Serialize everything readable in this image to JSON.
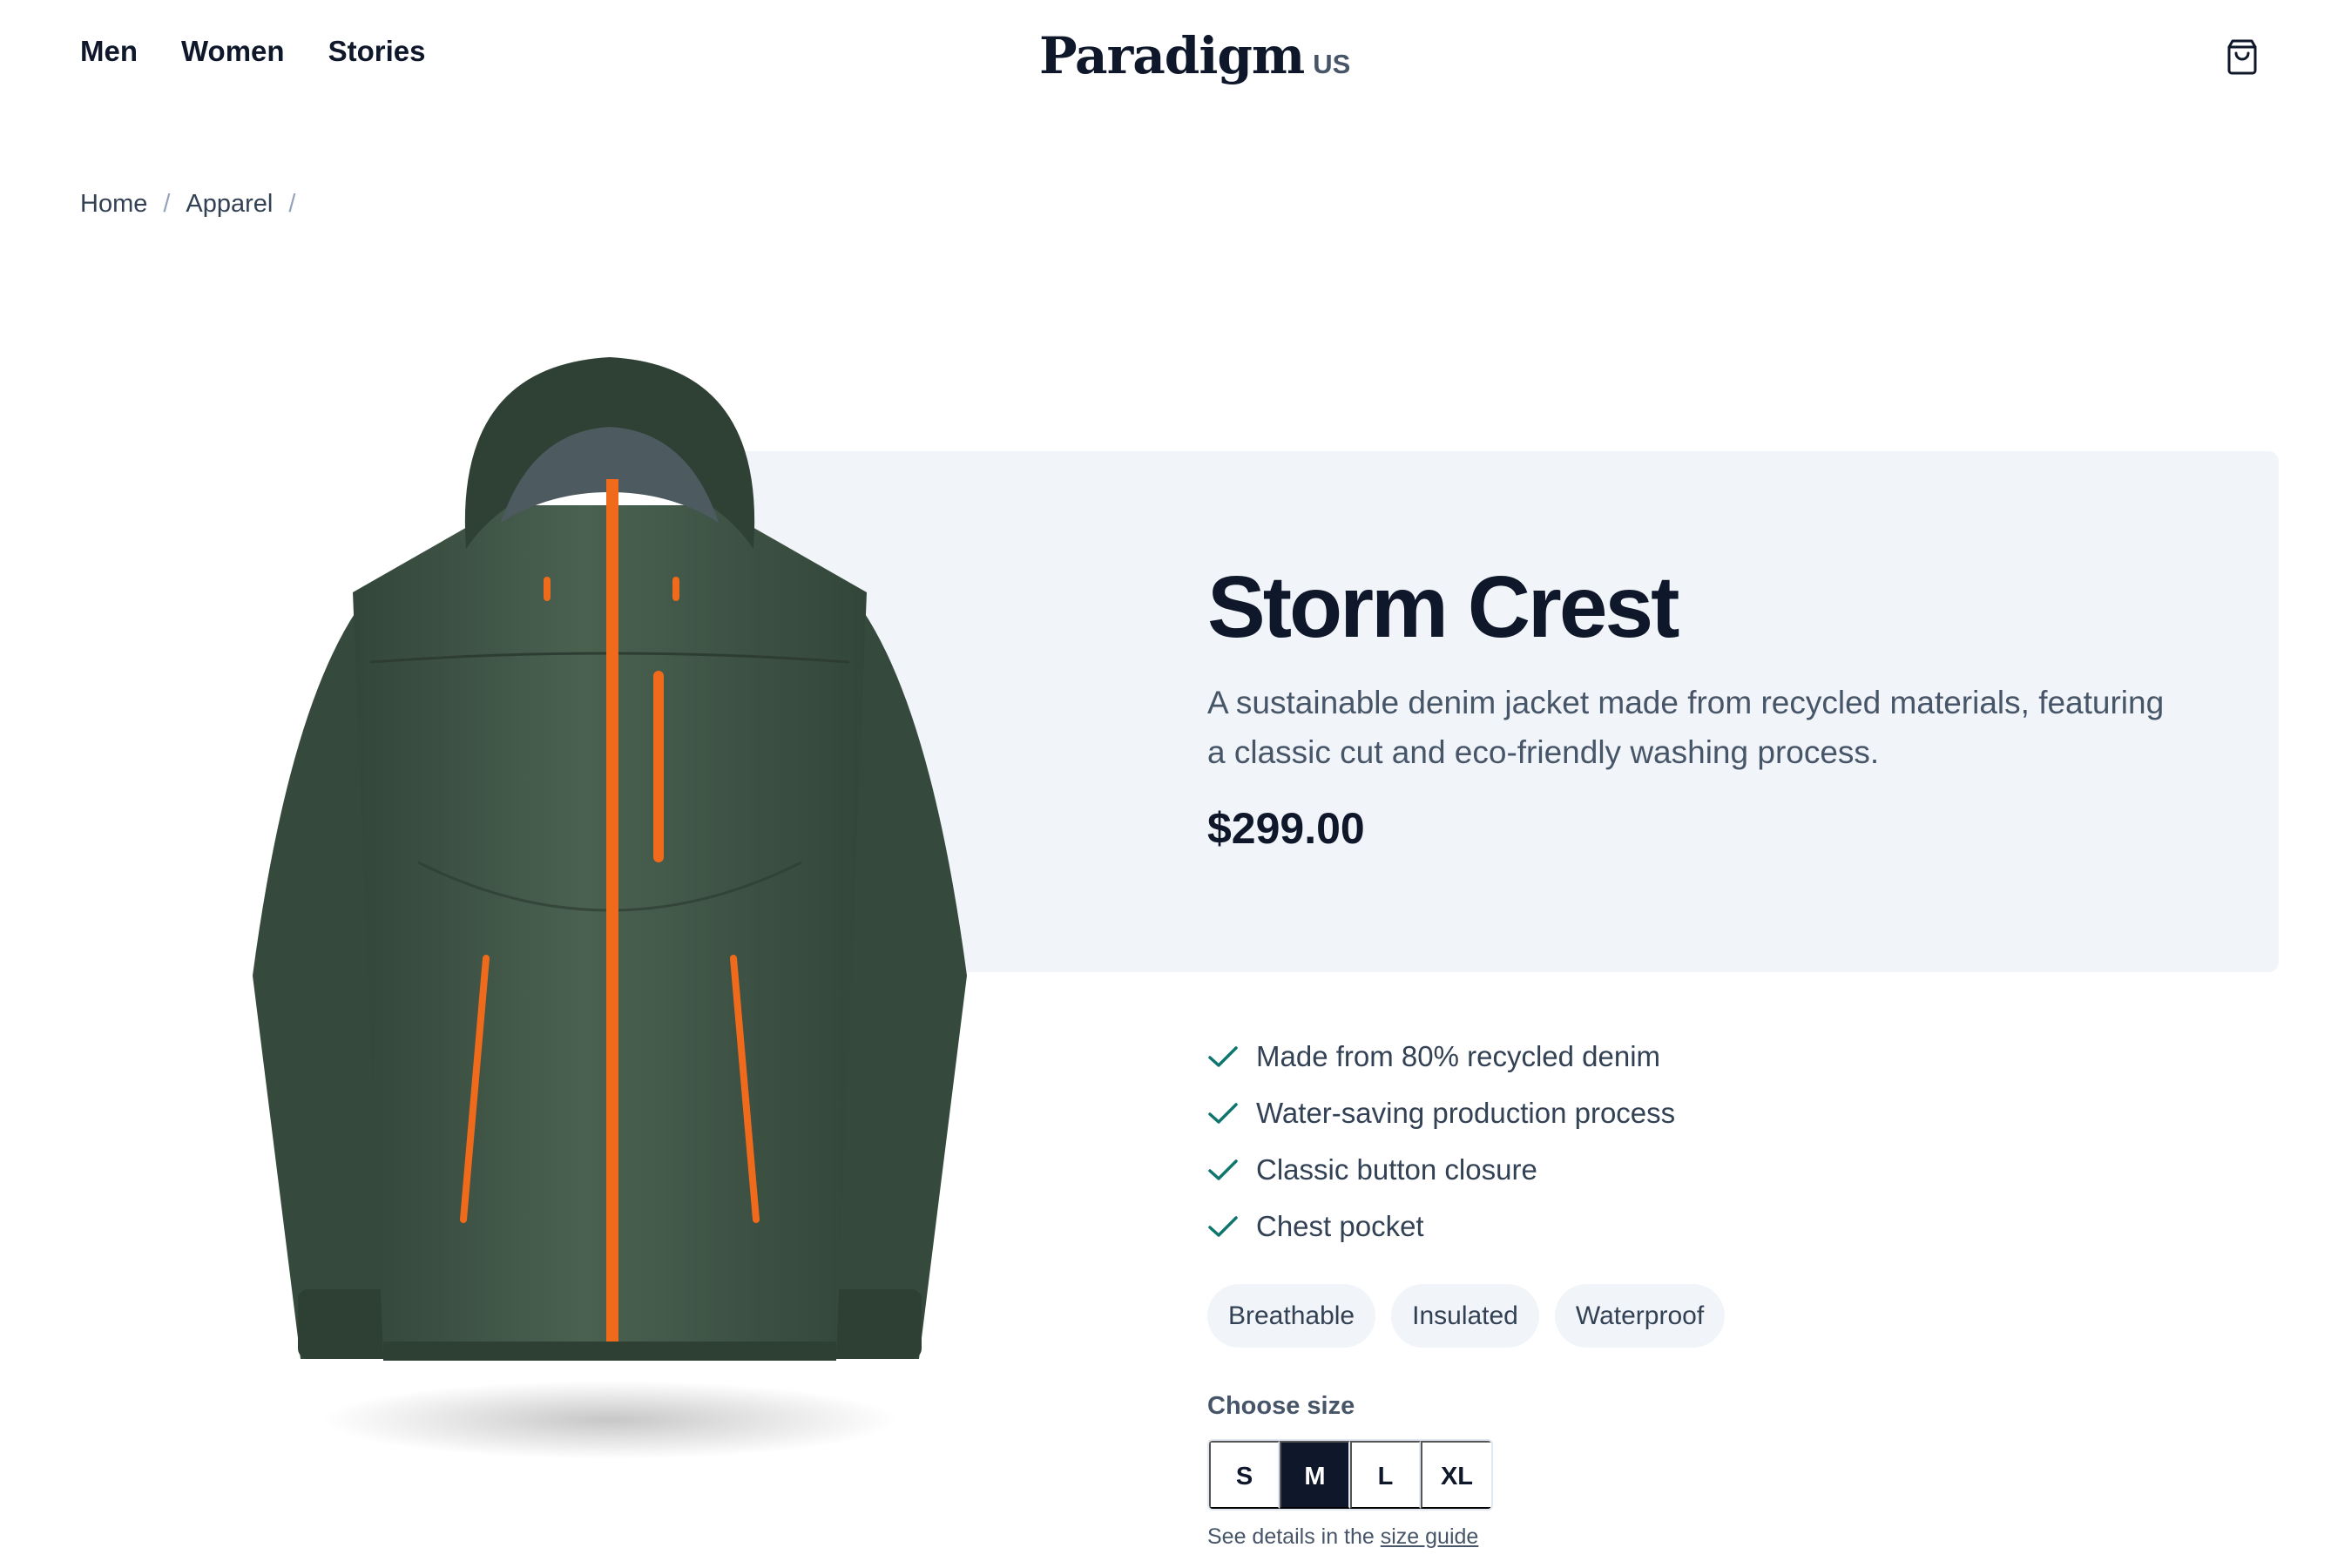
{
  "header": {
    "nav": [
      "Men",
      "Women",
      "Stories"
    ],
    "logo": "Paradigm",
    "region": "US",
    "cart_icon": "shopping-bag-icon"
  },
  "breadcrumb": [
    "Home",
    "Apparel"
  ],
  "product": {
    "title": "Storm Crest",
    "description": "A sustainable denim jacket made from recycled materials, featuring a classic cut and eco-friendly washing process.",
    "price": "$299.00",
    "features": [
      "Made from 80% recycled denim",
      "Water-saving production process",
      "Classic button closure",
      "Chest pocket"
    ],
    "tags": [
      "Breathable",
      "Insulated",
      "Waterproof"
    ],
    "size_label": "Choose size",
    "sizes": [
      "S",
      "M",
      "L",
      "XL"
    ],
    "selected_size": "M",
    "size_note_prefix": "See details in the",
    "size_guide_link": "size guide"
  },
  "colors": {
    "text_dark": "#0f172a",
    "panel_bg": "#f1f4f8",
    "check_accent": "#0f766e",
    "jacket_green": "#3f5446",
    "zipper_orange": "#f06a1c"
  }
}
